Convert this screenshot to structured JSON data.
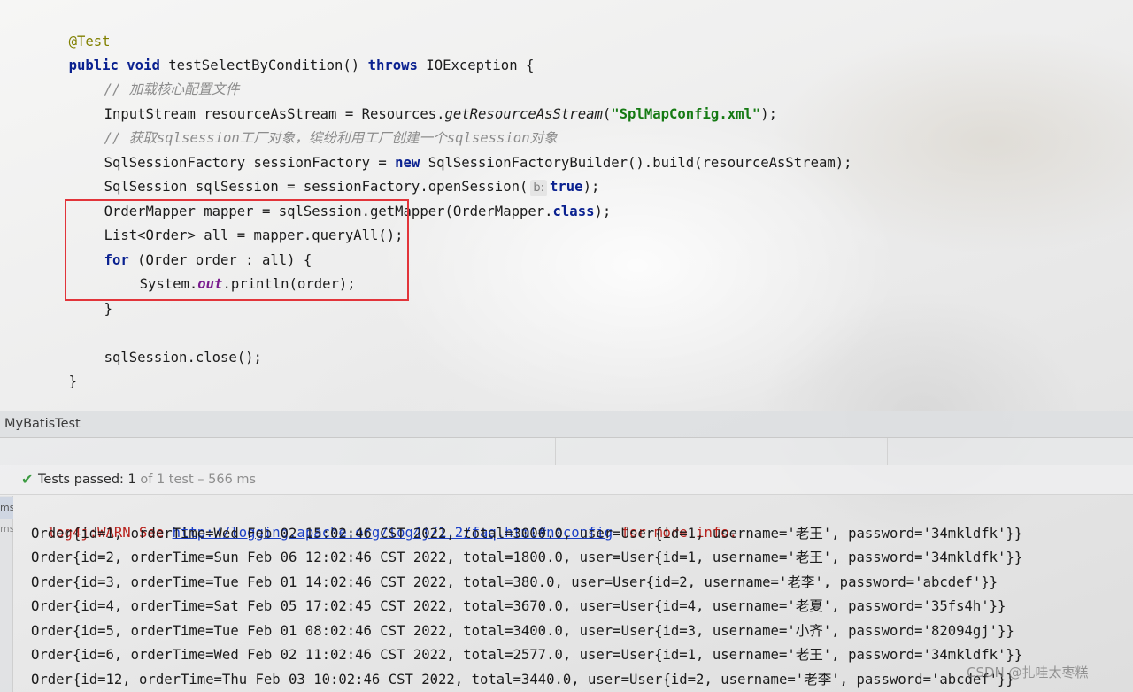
{
  "editor": {
    "annotation": "@Test",
    "kw_public": "public",
    "kw_void": "void",
    "method_sig": " testSelectByCondition() ",
    "kw_throws": "throws",
    "throws_rest": " IOException {",
    "comment_load": "// 加载核心配置文件",
    "line_stream_a": "InputStream resourceAsStream = Resources.",
    "line_stream_method": "getResourceAsStream",
    "line_stream_open": "(",
    "line_stream_str": "\"SplMapConfig.xml\"",
    "line_stream_close": ");",
    "comment_factory": "// 获取sqlsession工厂对象，缤纷利用工厂创建一个sqlsession对象",
    "line_factory_a": "SqlSessionFactory sessionFactory = ",
    "kw_new": "new",
    "line_factory_b": " SqlSessionFactoryBuilder().build(resourceAsStream);",
    "line_session_a": "SqlSession sqlSession = sessionFactory.openSession(",
    "param_hint": "b:",
    "kw_true": "true",
    "line_session_b": ");",
    "line_mapper_a": "OrderMapper mapper = sqlSession.getMapper(OrderMapper.",
    "kw_class": "class",
    "line_mapper_b": ");",
    "line_list": "List<Order> all = mapper.queryAll();",
    "kw_for": "for",
    "line_for_rest": " (Order order : all) {",
    "line_print_a": "System.",
    "field_out": "out",
    "line_print_b": ".println(order);",
    "line_close_brace": "}",
    "line_session_close": "sqlSession.close();",
    "line_method_close": "}"
  },
  "run_panel": {
    "title": "MyBatisTest",
    "status_passed": "Tests passed:",
    "status_count": " 1",
    "status_detail": " of 1 test – 566 ms",
    "gutter": [
      "ms",
      "ms"
    ]
  },
  "console": {
    "warn_prefix": "log4j:WARN See ",
    "warn_link": "http://logging.apache.org/log4j/1.2/faq.html#noconfig",
    "warn_suffix": " for more info.",
    "lines": [
      "Order{id=1, orderTime=Wed Feb 02 15:02:46 CST 2022, total=3000.0, user=User{id=1, username='老王', password='34mkldfk'}}",
      "Order{id=2, orderTime=Sun Feb 06 12:02:46 CST 2022, total=1800.0, user=User{id=1, username='老王', password='34mkldfk'}}",
      "Order{id=3, orderTime=Tue Feb 01 14:02:46 CST 2022, total=380.0, user=User{id=2, username='老李', password='abcdef'}}",
      "Order{id=4, orderTime=Sat Feb 05 17:02:45 CST 2022, total=3670.0, user=User{id=4, username='老夏', password='35fs4h'}}",
      "Order{id=5, orderTime=Tue Feb 01 08:02:46 CST 2022, total=3400.0, user=User{id=3, username='小齐', password='82094gj'}}",
      "Order{id=6, orderTime=Wed Feb 02 11:02:46 CST 2022, total=2577.0, user=User{id=1, username='老王', password='34mkldfk'}}",
      "Order{id=12, orderTime=Thu Feb 03 10:02:46 CST 2022, total=3440.0, user=User{id=2, username='老李', password='abcdef'}}"
    ]
  },
  "watermark": "CSDN @扎哇太枣糕",
  "colors": {
    "keyword": "#0a2190",
    "string": "#157a13",
    "comment": "#8c8c8c",
    "annotation": "#818000",
    "error": "#b8221d",
    "link": "#1b3fc6",
    "pass": "#3c9b41",
    "highlight_box": "#e2343a"
  },
  "icons": {
    "status": "check-icon"
  }
}
